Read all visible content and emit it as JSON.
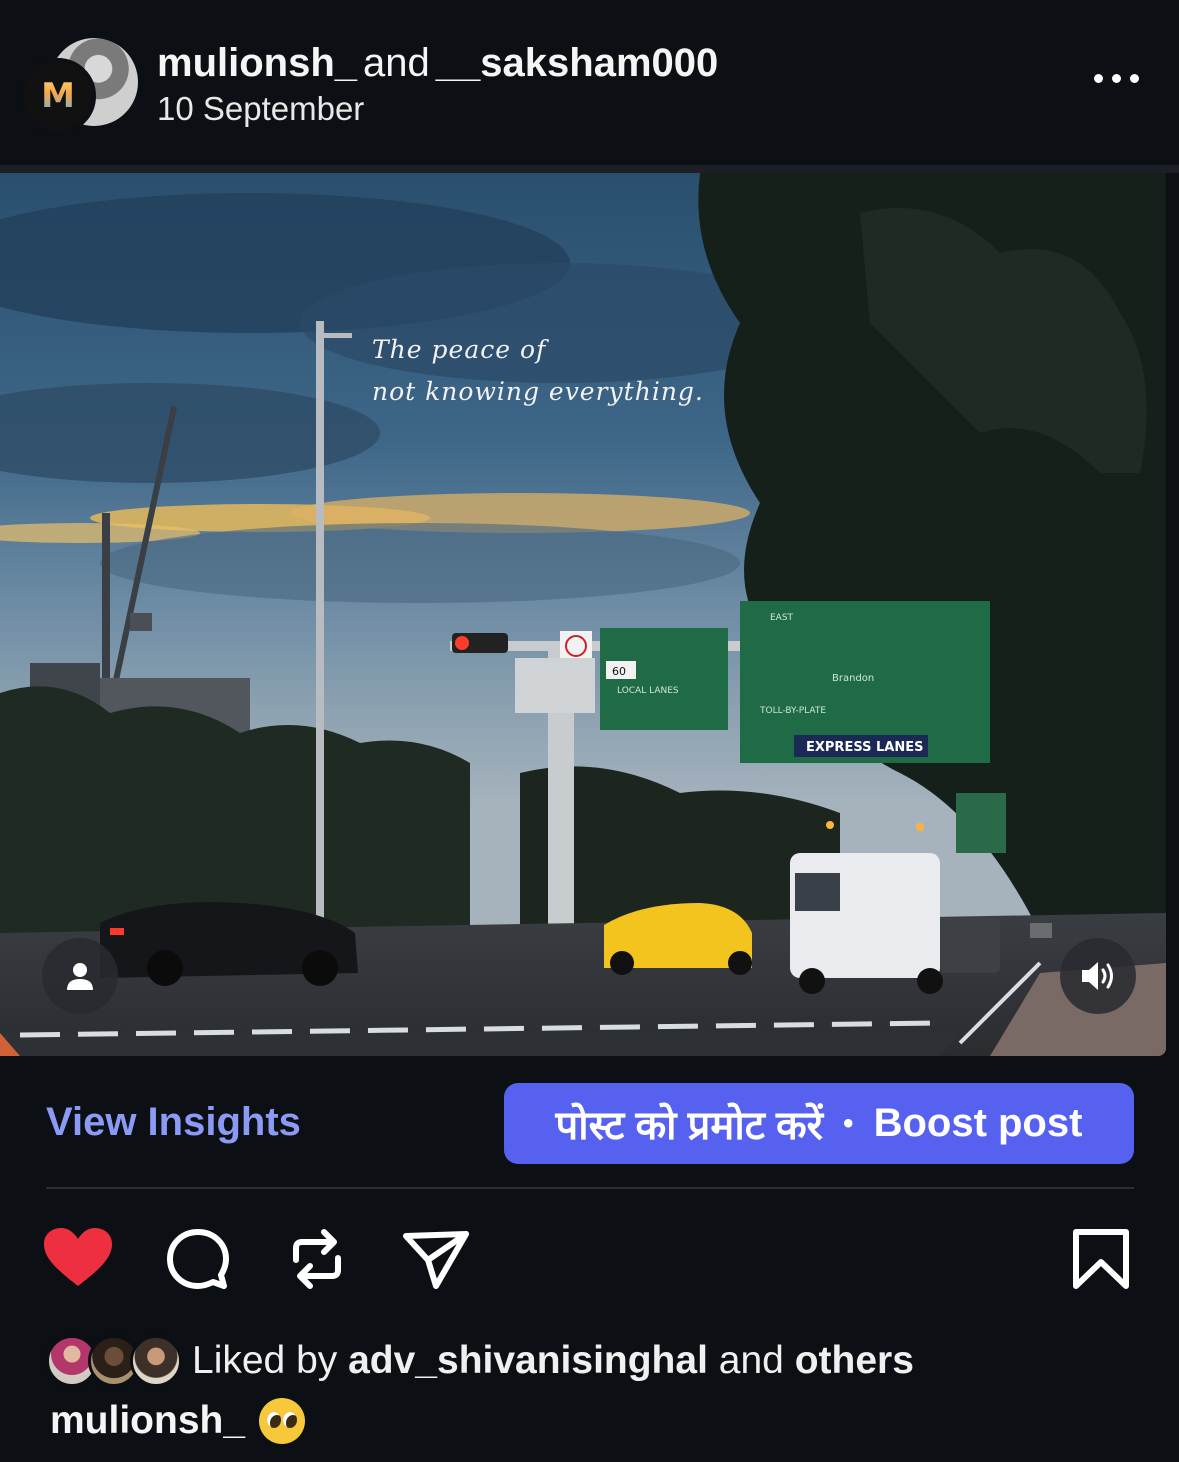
{
  "post": {
    "author": "mulionsh_",
    "connector": "and",
    "collaborator": "__saksham000",
    "date": "10 September",
    "avatar_letter": "M",
    "more_icon": "more-horizontal-icon"
  },
  "media": {
    "overlay_line1": "The peace of",
    "overlay_line2": "not knowing everything.",
    "sign_express": "EXPRESS LANES",
    "sign_local": "LOCAL LANES",
    "sign_toll": "TOLL-BY-PLATE",
    "sign_east": "EAST",
    "sign_brandon": "Brandon",
    "sign_route": "60",
    "tag_icon": "person-tag-icon",
    "sound_icon": "speaker-on-icon"
  },
  "actions_bar": {
    "insights_label": "View Insights",
    "boost_hindi": "पोस्ट को प्रमोट करें",
    "boost_separator": "•",
    "boost_label": "Boost post"
  },
  "icons": {
    "like": "heart-filled-icon",
    "comment": "comment-icon",
    "repost": "repost-icon",
    "share": "send-icon",
    "save": "bookmark-icon",
    "like_color": "#ed2f3f"
  },
  "likes": {
    "prefix": "Liked by",
    "user": "adv_shivanisinghal",
    "middle": "and",
    "suffix": "others"
  },
  "caption": {
    "user": "mulionsh_",
    "emoji": "pleading-face-emoji"
  }
}
